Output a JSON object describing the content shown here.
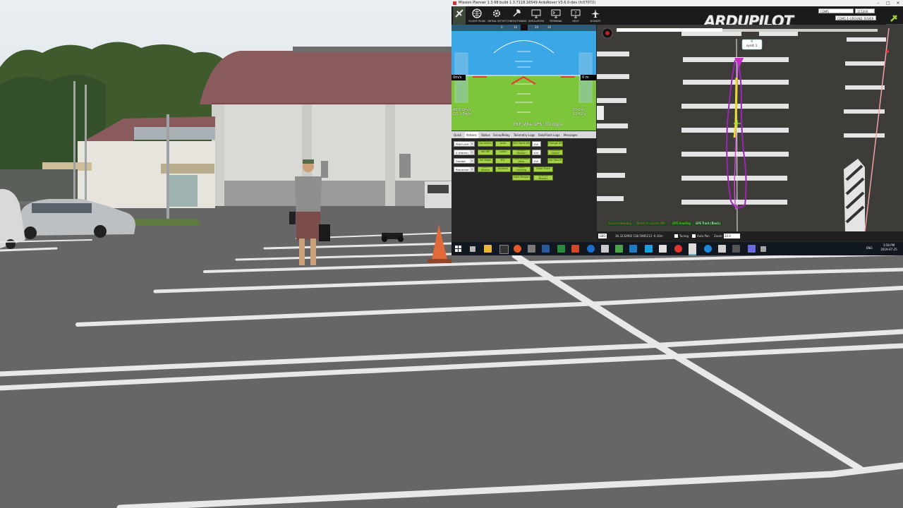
{
  "window": {
    "title": "Mission Planner 1.3.68 build 1.3.7118.16549 ArduRover V3.6.0-dev (fc07072)"
  },
  "menu": [
    {
      "label": "FLIGHT PLAN",
      "icon": "globe-icon"
    },
    {
      "label": "INITIAL SETUP",
      "icon": "gear-icon"
    },
    {
      "label": "CONFIG/TUNING",
      "icon": "wrench-icon"
    },
    {
      "label": "SIMULATION",
      "icon": "monitor-plane-icon"
    },
    {
      "label": "TERMINAL",
      "icon": "terminal-icon"
    },
    {
      "label": "HELP",
      "icon": "help-monitor-icon"
    },
    {
      "label": "DONATE",
      "icon": "plane-icon"
    }
  ],
  "brand": "ARDUPILOT",
  "connection": {
    "port": "COM5",
    "baud": "115200",
    "vehicle": "COM5-1-GROUND_ROVER",
    "disconnect_label": "DISCONNECT"
  },
  "hud": {
    "ground_speed": "0m/s",
    "altitude": "0 m",
    "telemetry_left": "AS 0.0m/s\nGS 0.0m/s",
    "telemetry_right": "0>0 m\n12.62 v",
    "status": "EKF   Vibe   GPS: 3D dgps",
    "heading_ticks": [
      "0",
      "10",
      "20",
      "30",
      "40",
      "50"
    ]
  },
  "tabs": [
    "Quick",
    "Actions",
    "Status",
    "Servo/Relay",
    "Telemetry Logs",
    "DataFlash Logs",
    "Messages"
  ],
  "actions": {
    "combos": [
      "PREFLIGH",
      "0 (Home)",
      "Guided",
      "Retracted"
    ],
    "buttons": [
      [
        "Do Action",
        "Auto",
        "Set Home Alt",
        "100",
        "Change Alt"
      ],
      [
        "Set WP",
        "Loiter",
        "Restart Mission",
        "100",
        "Change Speed"
      ],
      [
        "Set Mode",
        "RTL",
        "Raw Sensor View",
        "100",
        "Set Mount"
      ],
      [
        "Arm Disarm",
        "Joystick",
        "Abort Landing",
        "Clear Track"
      ],
      [
        "Start Mission",
        "Resume Mission"
      ]
    ]
  },
  "map": {
    "vehicle_label": "0\nsysid: 1",
    "status": {
      "coords": "36.3232992 138.5985213 -0.16m",
      "tuning": "Tuning",
      "autopan": "Auto Pan",
      "zoom_label": "Zoom",
      "zoom": "22.0",
      "legend": [
        "Current Heading",
        "Direct to current WP",
        "GPS Heading",
        "GPS Track (Black)"
      ]
    }
  },
  "taskbar": {
    "lang": "ENG",
    "time": "3:58 PM",
    "date": "2019-07-25"
  },
  "colors": {
    "accent_green": "#a6d24a",
    "track_magenta": "#9b26b6",
    "track_yellow": "#e6dc2c",
    "brand_white": "#f1f1f1"
  }
}
